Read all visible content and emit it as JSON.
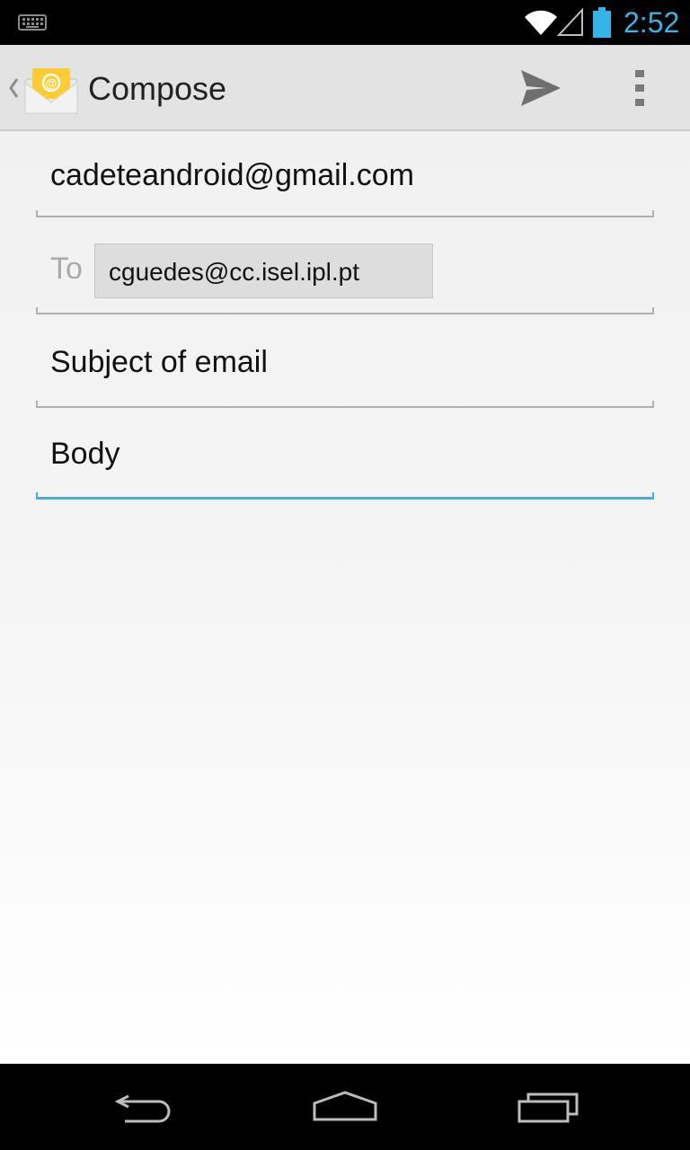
{
  "status_bar": {
    "time": "2:52",
    "icons": [
      "keyboard-icon",
      "wifi-icon",
      "signal-icon",
      "battery-icon"
    ]
  },
  "action_bar": {
    "title": "Compose",
    "app_icon": "email-envelope-icon",
    "actions": [
      "send-icon",
      "overflow-menu-icon"
    ]
  },
  "compose": {
    "from": "cadeteandroid@gmail.com",
    "to_label": "To",
    "recipients": [
      "cguedes@cc.isel.ipl.pt"
    ],
    "subject": "Subject of email",
    "body": "Body"
  },
  "nav_bar": {
    "buttons": [
      "back-icon",
      "home-icon",
      "recents-icon"
    ]
  },
  "colors": {
    "accent": "#33b5e5",
    "action_bar": "#e3e3e3",
    "chip": "#dddddd",
    "hint": "#aaaaaa"
  }
}
